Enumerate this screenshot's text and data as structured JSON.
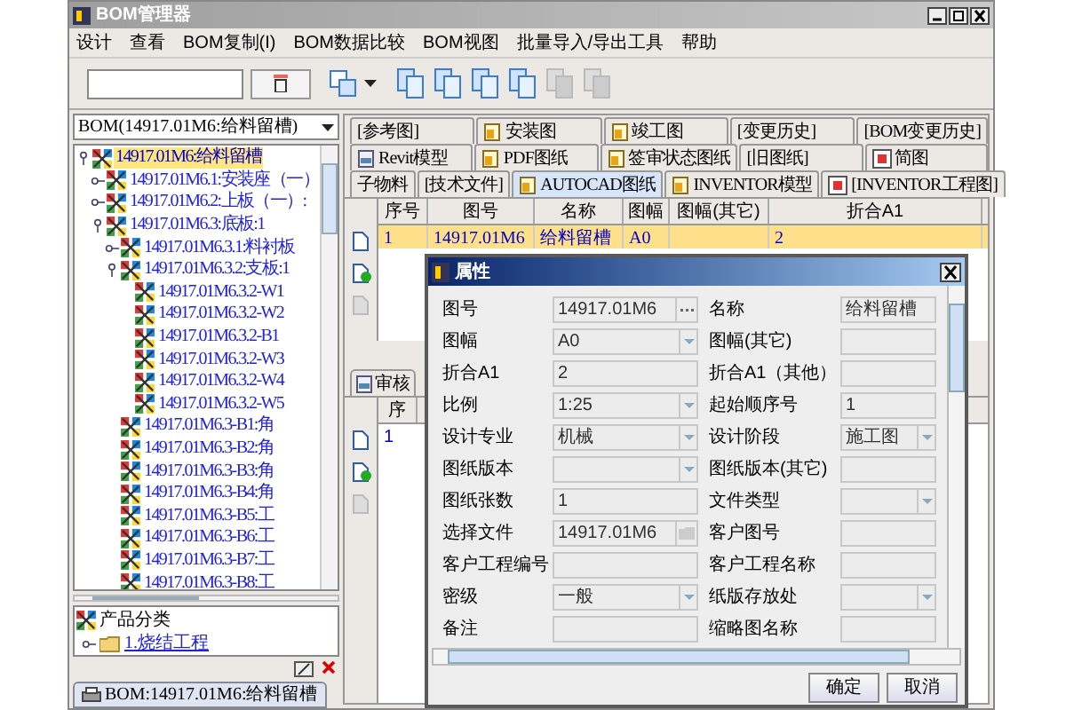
{
  "window": {
    "title": "BOM管理器"
  },
  "menu": [
    "设计",
    "查看",
    "BOM复制(I)",
    "BOM数据比较",
    "BOM视图",
    "批量导入/导出工具",
    "帮助"
  ],
  "toolbar": {
    "disabled_tools": [
      false,
      false,
      false,
      false,
      true,
      true
    ]
  },
  "left_panel": {
    "bom_select": {
      "value": "BOM(14917.01M6:给料留槽)"
    },
    "tree": [
      {
        "label": "14917.01M6:给料留槽",
        "selected": true,
        "expanded": true,
        "children": [
          {
            "label": "14917.01M6.1:安装座（一）",
            "selected": false,
            "expanded": false
          },
          {
            "label": "14917.01M6.2:上板（一）:",
            "selected": false,
            "expanded": false
          },
          {
            "label": "14917.01M6.3:底板:1",
            "selected": false,
            "expanded": true,
            "children": [
              {
                "label": "14917.01M6.3.1:料衬板",
                "selected": false,
                "expanded": false
              },
              {
                "label": "14917.01M6.3.2:支板:1",
                "selected": false,
                "expanded": true,
                "children": [
                  {
                    "label": "14917.01M6.3.2-W1",
                    "selected": false
                  },
                  {
                    "label": "14917.01M6.3.2-W2",
                    "selected": false
                  },
                  {
                    "label": "14917.01M6.3.2-B1",
                    "selected": false
                  },
                  {
                    "label": "14917.01M6.3.2-W3",
                    "selected": false
                  },
                  {
                    "label": "14917.01M6.3.2-W4",
                    "selected": false
                  },
                  {
                    "label": "14917.01M6.3.2-W5",
                    "selected": false
                  }
                ]
              },
              {
                "label": "14917.01M6.3-B1:角",
                "selected": false
              },
              {
                "label": "14917.01M6.3-B2:角",
                "selected": false
              },
              {
                "label": "14917.01M6.3-B3:角",
                "selected": false
              },
              {
                "label": "14917.01M6.3-B4:角",
                "selected": false
              },
              {
                "label": "14917.01M6.3-B5:工",
                "selected": false
              },
              {
                "label": "14917.01M6.3-B6:工",
                "selected": false
              },
              {
                "label": "14917.01M6.3-B7:工",
                "selected": false
              },
              {
                "label": "14917.01M6.3-B8:工",
                "selected": false
              }
            ]
          }
        ]
      }
    ],
    "category_tree": [
      {
        "label": "产品分类",
        "children": [
          {
            "label": "1.烧结工程",
            "expanded": false
          }
        ]
      }
    ],
    "bottom_tab": "BOM:14917.01M6:给料留槽"
  },
  "right_panel": {
    "tab_rows": [
      [
        {
          "label": "[参考图]",
          "kind": "plain",
          "selected": false
        },
        {
          "label": "安装图",
          "kind": "doc",
          "selected": false
        },
        {
          "label": "竣工图",
          "kind": "doc",
          "selected": false
        },
        {
          "label": "[变更历史]",
          "kind": "plain",
          "selected": false
        },
        {
          "label": "[BOM变更历史]",
          "kind": "plain",
          "selected": false
        }
      ],
      [
        {
          "label": "Revit模型",
          "kind": "file",
          "selected": false
        },
        {
          "label": "PDF图纸",
          "kind": "doc",
          "selected": false
        },
        {
          "label": "签审状态图纸",
          "kind": "doc",
          "selected": false
        },
        {
          "label": "[旧图纸]",
          "kind": "plain",
          "selected": false
        },
        {
          "label": "简图",
          "kind": "image",
          "selected": false
        }
      ],
      [
        {
          "label": "子物料",
          "kind": "plain",
          "selected": false
        },
        {
          "label": "[技术文件]",
          "kind": "plain",
          "selected": false
        },
        {
          "label": "AUTOCAD图纸",
          "kind": "doc",
          "selected": true
        },
        {
          "label": "INVENTOR模型",
          "kind": "doc",
          "selected": false
        },
        {
          "label": "[INVENTOR工程图]",
          "kind": "image",
          "selected": false
        }
      ]
    ],
    "table": {
      "columns": [
        "序号",
        "图号",
        "名称",
        "图幅",
        "图幅(其它)",
        "折合A1"
      ],
      "rows": [
        {
          "cells": [
            "1",
            "14917.01M6",
            "给料留槽",
            "A0",
            "",
            "2"
          ],
          "selected": true
        }
      ]
    },
    "lower_tab": "审核",
    "lower_table": {
      "columns": [
        "序"
      ],
      "rows": [
        [
          "1"
        ]
      ]
    }
  },
  "dialog": {
    "title": "属性",
    "fields": [
      {
        "label": "图号",
        "value": "14917.01M6",
        "kind": "browse"
      },
      {
        "label": "名称",
        "value": "给料留槽",
        "kind": "text"
      },
      {
        "label": "图幅",
        "value": "A0",
        "kind": "select"
      },
      {
        "label": "图幅(其它)",
        "kind": "text"
      },
      {
        "label": "折合A1",
        "value": "2",
        "kind": "text"
      },
      {
        "label": "折合A1（其他）",
        "kind": "text"
      },
      {
        "label": "比例",
        "value": "1:25",
        "kind": "select"
      },
      {
        "label": "起始顺序号",
        "value": "1",
        "kind": "text"
      },
      {
        "label": "设计专业",
        "value": "机械",
        "kind": "select"
      },
      {
        "label": "设计阶段",
        "value": "施工图",
        "kind": "select"
      },
      {
        "label": "图纸版本",
        "kind": "select"
      },
      {
        "label": "图纸版本(其它)",
        "kind": "text"
      },
      {
        "label": "图纸张数",
        "value": "1",
        "kind": "text"
      },
      {
        "label": "文件类型",
        "kind": "select"
      },
      {
        "label": "选择文件",
        "value": "14917.01M6",
        "kind": "file"
      },
      {
        "label": "客户图号",
        "kind": "text"
      },
      {
        "label": "客户工程编号",
        "kind": "text"
      },
      {
        "label": "客户工程名称",
        "kind": "text"
      },
      {
        "label": "密级",
        "value": "一般",
        "kind": "select"
      },
      {
        "label": "纸版存放处",
        "kind": "select"
      },
      {
        "label": "备注",
        "kind": "text"
      },
      {
        "label": "缩略图名称",
        "kind": "text"
      }
    ],
    "buttons": [
      "确定",
      "取消"
    ]
  }
}
